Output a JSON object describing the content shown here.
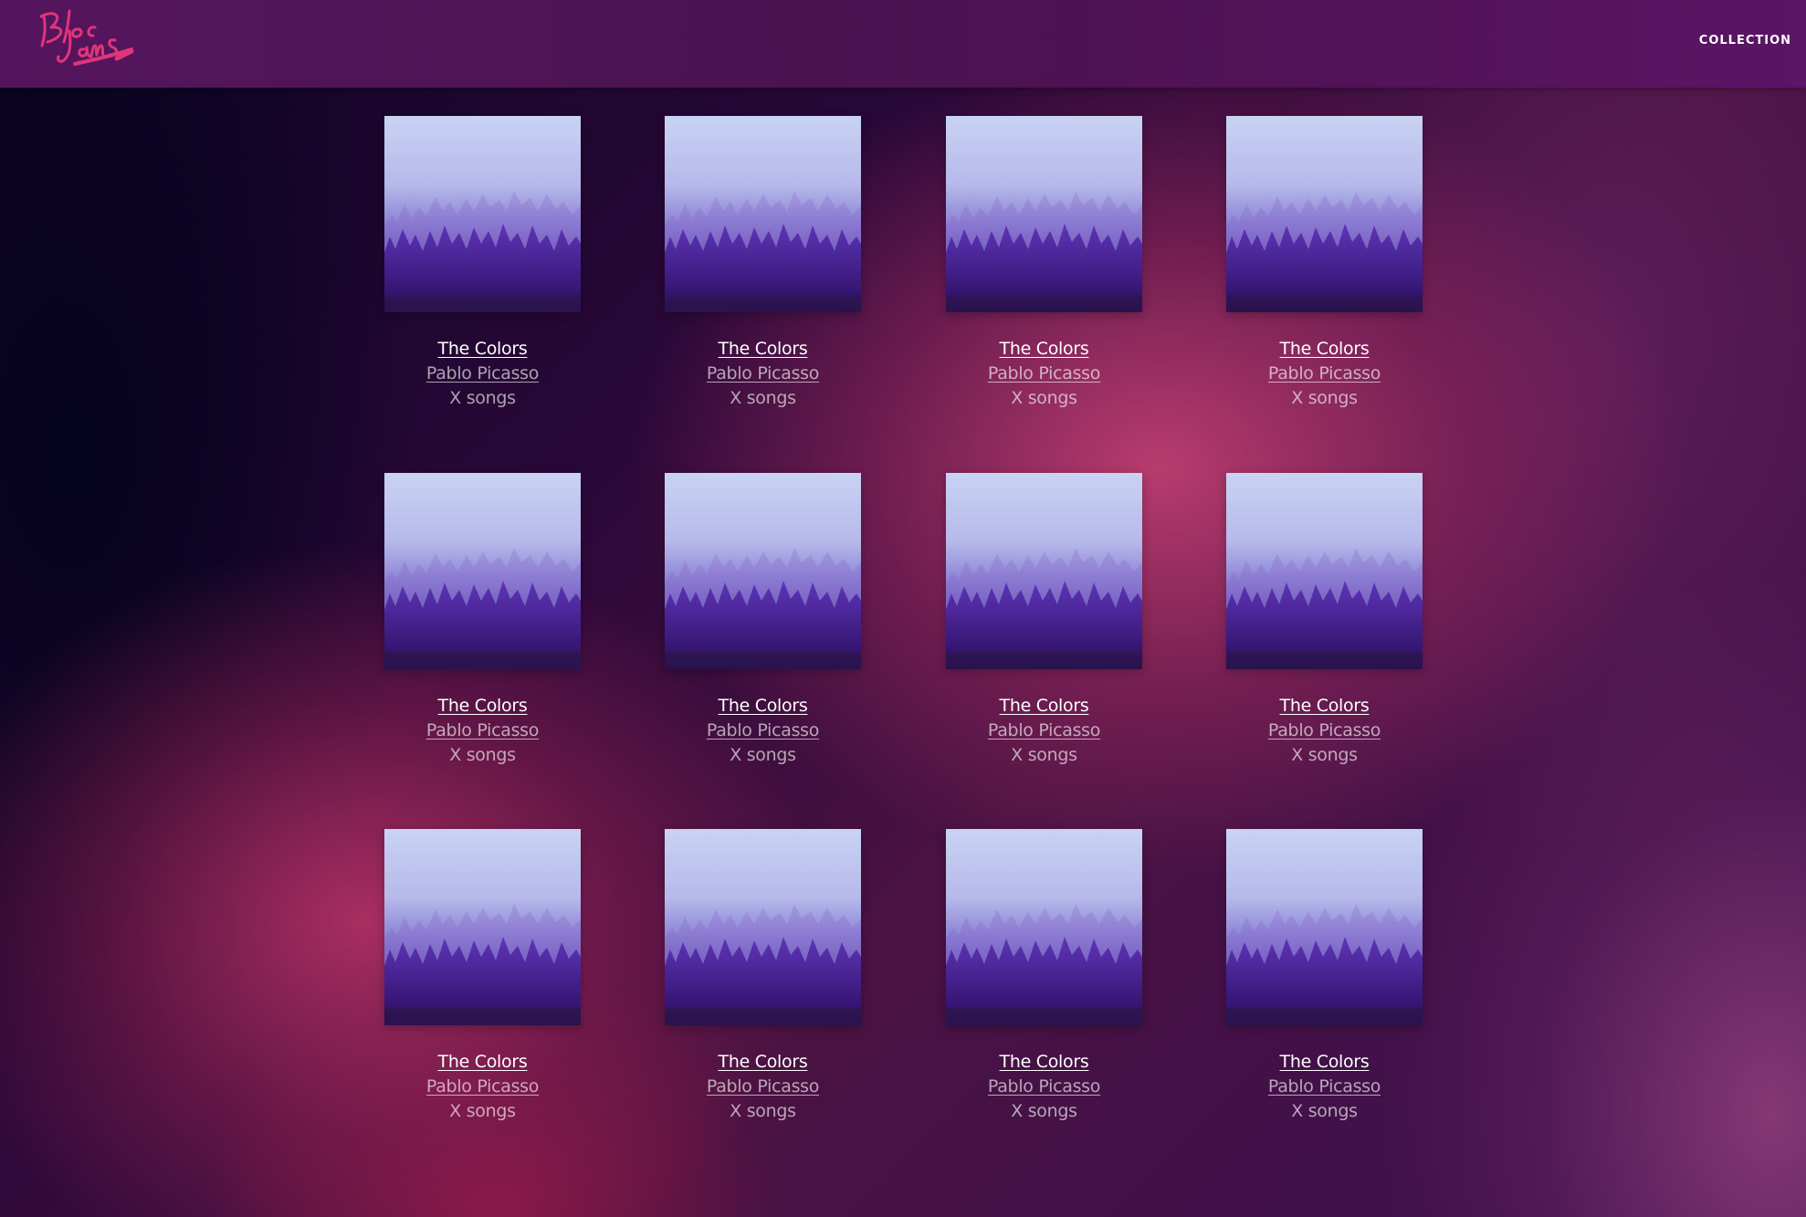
{
  "header": {
    "logo_alt": "Bloc Jams",
    "nav": [
      {
        "label": "COLLECTION"
      }
    ]
  },
  "albums": [
    {
      "title": "The Colors",
      "artist": "Pablo Picasso",
      "songs": "X songs"
    },
    {
      "title": "The Colors",
      "artist": "Pablo Picasso",
      "songs": "X songs"
    },
    {
      "title": "The Colors",
      "artist": "Pablo Picasso",
      "songs": "X songs"
    },
    {
      "title": "The Colors",
      "artist": "Pablo Picasso",
      "songs": "X songs"
    },
    {
      "title": "The Colors",
      "artist": "Pablo Picasso",
      "songs": "X songs"
    },
    {
      "title": "The Colors",
      "artist": "Pablo Picasso",
      "songs": "X songs"
    },
    {
      "title": "The Colors",
      "artist": "Pablo Picasso",
      "songs": "X songs"
    },
    {
      "title": "The Colors",
      "artist": "Pablo Picasso",
      "songs": "X songs"
    },
    {
      "title": "The Colors",
      "artist": "Pablo Picasso",
      "songs": "X songs"
    },
    {
      "title": "The Colors",
      "artist": "Pablo Picasso",
      "songs": "X songs"
    },
    {
      "title": "The Colors",
      "artist": "Pablo Picasso",
      "songs": "X songs"
    },
    {
      "title": "The Colors",
      "artist": "Pablo Picasso",
      "songs": "X songs"
    }
  ],
  "colors": {
    "header_bg": "#531258",
    "logo_pink": "#e0357a",
    "text_primary": "#ffffff"
  }
}
